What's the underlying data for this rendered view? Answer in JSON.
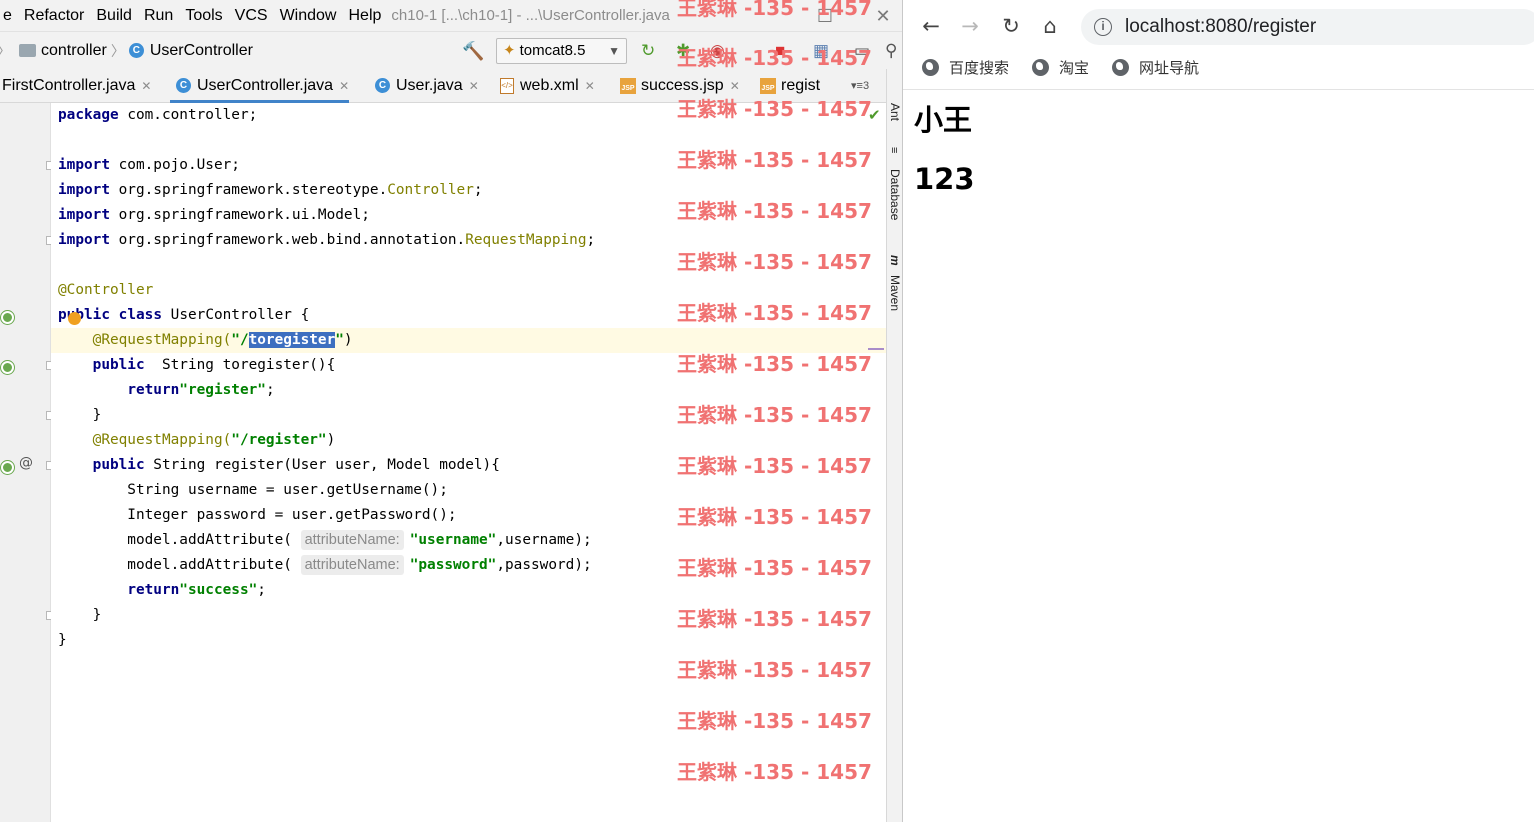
{
  "ide": {
    "menu": [
      "e",
      "Refactor",
      "Build",
      "Run",
      "Tools",
      "VCS",
      "Window",
      "Help"
    ],
    "window_title": "ch10-1 [...\\ch10-1] - ...\\UserController.java",
    "breadcrumb": {
      "folder": "controller",
      "class": "UserController",
      "class_icon": "C"
    },
    "run_config": "tomcat8.5",
    "tabs": [
      {
        "label": "FirstController.java",
        "icon": "none"
      },
      {
        "label": "UserController.java",
        "icon": "class-icon",
        "active": true
      },
      {
        "label": "User.java",
        "icon": "class-icon"
      },
      {
        "label": "web.xml",
        "icon": "xml-icon"
      },
      {
        "label": "success.jsp",
        "icon": "jsp-icon"
      },
      {
        "label": "regist",
        "icon": "jsp-icon"
      }
    ],
    "tab_overflow": "3",
    "side_tools": [
      "Ant",
      "Database",
      "Maven"
    ],
    "code": {
      "l1": [
        "package",
        " com.controller;"
      ],
      "l3": [
        "import",
        " com.pojo.User;"
      ],
      "l4": [
        "import",
        " org.springframework.stereotype.",
        "Controller",
        ";"
      ],
      "l5": [
        "import",
        " org.springframework.ui.Model;"
      ],
      "l6": [
        "import",
        " org.springframework.web.bind.annotation.",
        "RequestMapping",
        ";"
      ],
      "l8": "@Controller",
      "l9": [
        "p",
        "u",
        "blic",
        " ",
        "class",
        " UserController {"
      ],
      "l10": [
        "    @RequestMapping(",
        "\"/",
        "toregister",
        "\"",
        ")"
      ],
      "l11": [
        "    ",
        "public",
        "  String toregister(){"
      ],
      "l12": [
        "        ",
        "return",
        "\"register\"",
        ";"
      ],
      "l13": "    }",
      "l14": [
        "    @RequestMapping(",
        "\"/register\"",
        ")"
      ],
      "l15": [
        "    ",
        "public",
        " String register(User user, Model model){"
      ],
      "l16": "        String username = user.getUsername();",
      "l17": "        Integer password = user.getPassword();",
      "l18": [
        "        model.addAttribute( ",
        "attributeName:",
        "\"username\"",
        ",username);"
      ],
      "l19": [
        "        model.addAttribute( ",
        "attributeName:",
        "\"password\"",
        ",password);"
      ],
      "l20": [
        "        ",
        "return",
        "\"success\"",
        ";"
      ],
      "l21": "    }",
      "l22": "}"
    },
    "watermark": "王紫琳 -135 - 1457"
  },
  "browser": {
    "back": "←",
    "forward": "→",
    "reload": "↻",
    "home": "⌂",
    "url": "localhost:8080/register",
    "bookmarks": [
      "百度搜索",
      "淘宝",
      "网址导航"
    ],
    "content": {
      "username": "小王",
      "password": "123"
    }
  }
}
